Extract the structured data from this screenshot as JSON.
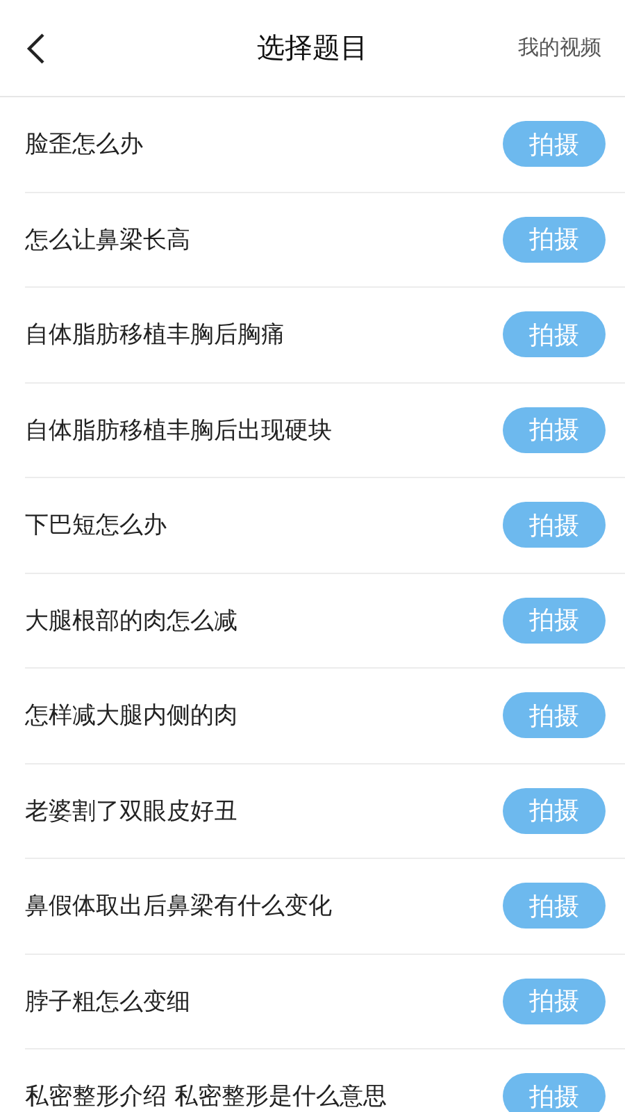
{
  "header": {
    "title": "选择题目",
    "action": "我的视频"
  },
  "topics": [
    {
      "title": "脸歪怎么办",
      "button": "拍摄"
    },
    {
      "title": "怎么让鼻梁长高",
      "button": "拍摄"
    },
    {
      "title": "自体脂肪移植丰胸后胸痛",
      "button": "拍摄"
    },
    {
      "title": "自体脂肪移植丰胸后出现硬块",
      "button": "拍摄"
    },
    {
      "title": "下巴短怎么办",
      "button": "拍摄"
    },
    {
      "title": "大腿根部的肉怎么减",
      "button": "拍摄"
    },
    {
      "title": "怎样减大腿内侧的肉",
      "button": "拍摄"
    },
    {
      "title": "老婆割了双眼皮好丑",
      "button": "拍摄"
    },
    {
      "title": "鼻假体取出后鼻梁有什么变化",
      "button": "拍摄"
    },
    {
      "title": "脖子粗怎么变细",
      "button": "拍摄"
    },
    {
      "title": "私密整形介绍 私密整形是什么意思",
      "button": "拍摄"
    }
  ]
}
